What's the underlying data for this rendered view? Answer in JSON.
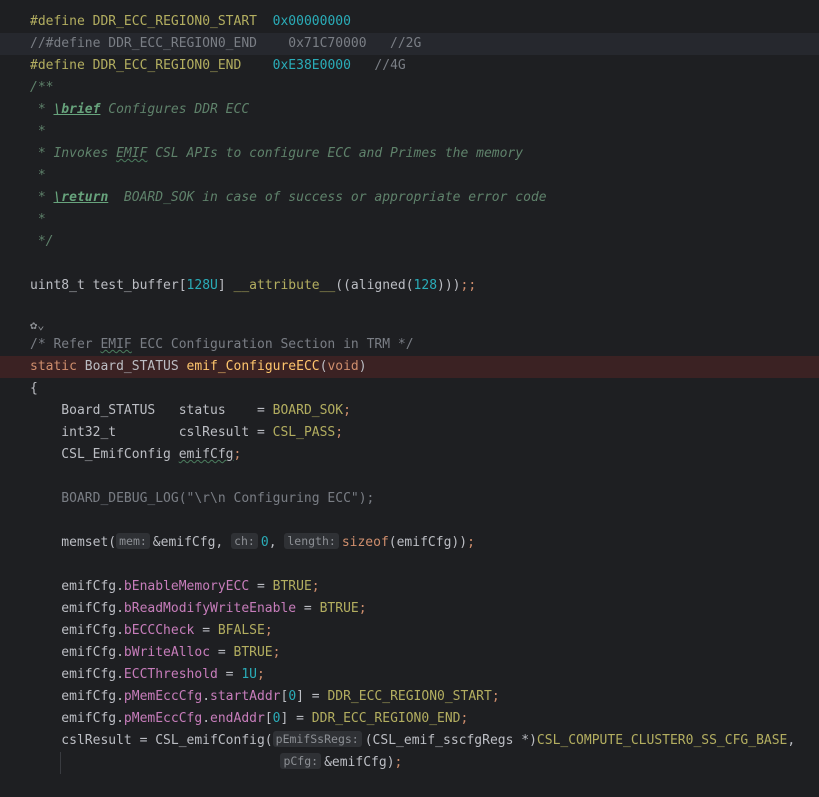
{
  "code": {
    "l1": {
      "kw": "#define",
      "name": "DDR_ECC_REGION0_START",
      "sp": "  ",
      "val": "0x00000000"
    },
    "l2": {
      "text": "//#define DDR_ECC_REGION0_END    0x71C70000   //2G"
    },
    "l3": {
      "kw": "#define",
      "name": "DDR_ECC_REGION0_END",
      "sp": "    ",
      "val": "0xE38E0000",
      "sp2": "   ",
      "cmt": "//4G"
    },
    "l4": {
      "text": "/**"
    },
    "l5": {
      "pre": " * ",
      "tag": "\\brief",
      "post": " Configures DDR ECC"
    },
    "l6": {
      "text": " *"
    },
    "l7": {
      "pre": " * Invokes ",
      "typo": "EMIF",
      "post": " CSL APIs to configure ECC and Primes the memory"
    },
    "l8": {
      "text": " *"
    },
    "l9": {
      "pre": " * ",
      "tag": "\\return",
      "post": "  BOARD_SOK in case of success or appropriate error code"
    },
    "l10": {
      "text": " *"
    },
    "l11": {
      "text": " */"
    },
    "l13": {
      "type": "uint8_t test_buffer[",
      "num": "128U",
      "close": "] ",
      "attr": "__attribute__",
      "rest": "((aligned(",
      "num2": "128",
      "end": ")))",
      "semi": ";;"
    },
    "l15": {
      "icon": "ai-assistant-icon",
      "chev": "⌄"
    },
    "l16": {
      "pre": "/* Refer ",
      "typo": "EMIF",
      "post": " ECC Configuration Section in TRM */"
    },
    "l17": {
      "kw": "static",
      "type": " Board_STATUS ",
      "fn": "emif_ConfigureECC",
      "open": "(",
      "void": "void",
      "close": ")"
    },
    "l18": {
      "text": "{"
    },
    "l19": {
      "pre": "    Board_STATUS   status    = ",
      "mac": "BOARD_SOK",
      "semi": ";"
    },
    "l20": {
      "pre": "    int32_t        cslResult = ",
      "mac": "CSL_PASS",
      "semi": ";"
    },
    "l21": {
      "pre": "    CSL_EmifConfig ",
      "typo": "emifCfg",
      "semi": ";"
    },
    "l23": {
      "pre": "    BOARD_DEBUG_LOG(\"\\r\\n Configuring ECC\");"
    },
    "l25": {
      "pre": "    memset(",
      "h1": "mem:",
      "a1": "&emifCfg, ",
      "h2": "ch:",
      "a2": "0",
      "c2": ", ",
      "h3": "length:",
      "kw": "sizeof",
      "a3": "(emifCfg))",
      "semi": ";"
    },
    "l27": {
      "pre": "    emifCfg.",
      "field": "bEnableMemoryECC",
      "mid": " = ",
      "mac": "BTRUE",
      "semi": ";"
    },
    "l28": {
      "pre": "    emifCfg.",
      "field": "bReadModifyWriteEnable",
      "mid": " = ",
      "mac": "BTRUE",
      "semi": ";"
    },
    "l29": {
      "pre": "    emifCfg.",
      "field": "bECCCheck",
      "mid": " = ",
      "mac": "BFALSE",
      "semi": ";"
    },
    "l30": {
      "pre": "    emifCfg.",
      "field": "bWriteAlloc",
      "mid": " = ",
      "mac": "BTRUE",
      "semi": ";"
    },
    "l31": {
      "pre": "    emifCfg.",
      "field": "ECCThreshold",
      "mid": " = ",
      "num": "1U",
      "semi": ";"
    },
    "l32": {
      "pre": "    emifCfg.",
      "field": "pMemEccCfg",
      "dot": ".",
      "field2": "startAddr",
      "br": "[",
      "num": "0",
      "br2": "] = ",
      "mac": "DDR_ECC_REGION0_START",
      "semi": ";"
    },
    "l33": {
      "pre": "    emifCfg.",
      "field": "pMemEccCfg",
      "dot": ".",
      "field2": "endAddr",
      "br": "[",
      "num": "0",
      "br2": "] = ",
      "mac": "DDR_ECC_REGION0_END",
      "semi": ";"
    },
    "l34": {
      "pre": "    cslResult = CSL_emifConfig(",
      "h1": "pEmifSsRegs:",
      "a1": "(CSL_emif_sscfgRegs *)",
      "mac": "CSL_COMPUTE_CLUSTER0_SS_CFG_BASE",
      ",": ","
    },
    "l35": {
      "pad": "                                ",
      "h1": "pCfg:",
      "a1": "&emifCfg)",
      "semi": ";"
    }
  },
  "colors": {
    "background": "#1e1f22",
    "keyword": "#cf8e6d",
    "macro": "#b3ae60",
    "number": "#2aacb8",
    "doc": "#5f826b",
    "field": "#c77dbb"
  }
}
